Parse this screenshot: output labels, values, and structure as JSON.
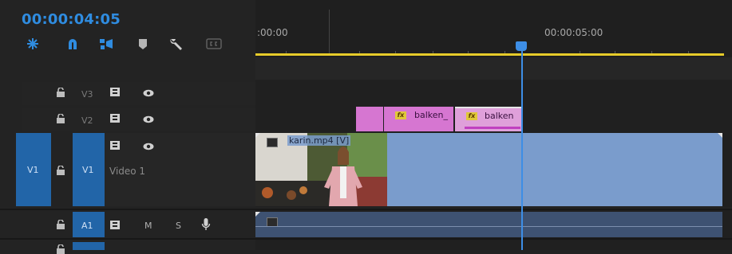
{
  "timecode": "00:00:04:05",
  "ruler": {
    "label_start": ":00:00",
    "label_5s": "00:00:05:00"
  },
  "tracks": {
    "v3": {
      "label": "V3"
    },
    "v2": {
      "label": "V2"
    },
    "v1": {
      "source": "V1",
      "label": "V1",
      "name": "Video 1"
    },
    "a1": {
      "label": "A1",
      "mute": "M",
      "solo": "S"
    }
  },
  "clips": {
    "balken1": "balken_",
    "balken2": "balken",
    "video": "karin.mp4 [V]",
    "fx": "fx"
  },
  "icons": [
    "snap-icon",
    "magnet-icon",
    "linked-selection-icon",
    "marker-icon",
    "wrench-icon",
    "captions-icon",
    "lock-icon",
    "toggle-output-icon",
    "eye-icon",
    "microphone-icon"
  ],
  "colors": {
    "accent": "#2f8ce0",
    "playhead": "#3d8ee6",
    "clip_pink": "#d676d1",
    "clip_blue": "#7a9ccc",
    "audio": "#3e5272",
    "work_area": "#e6cb2a"
  }
}
